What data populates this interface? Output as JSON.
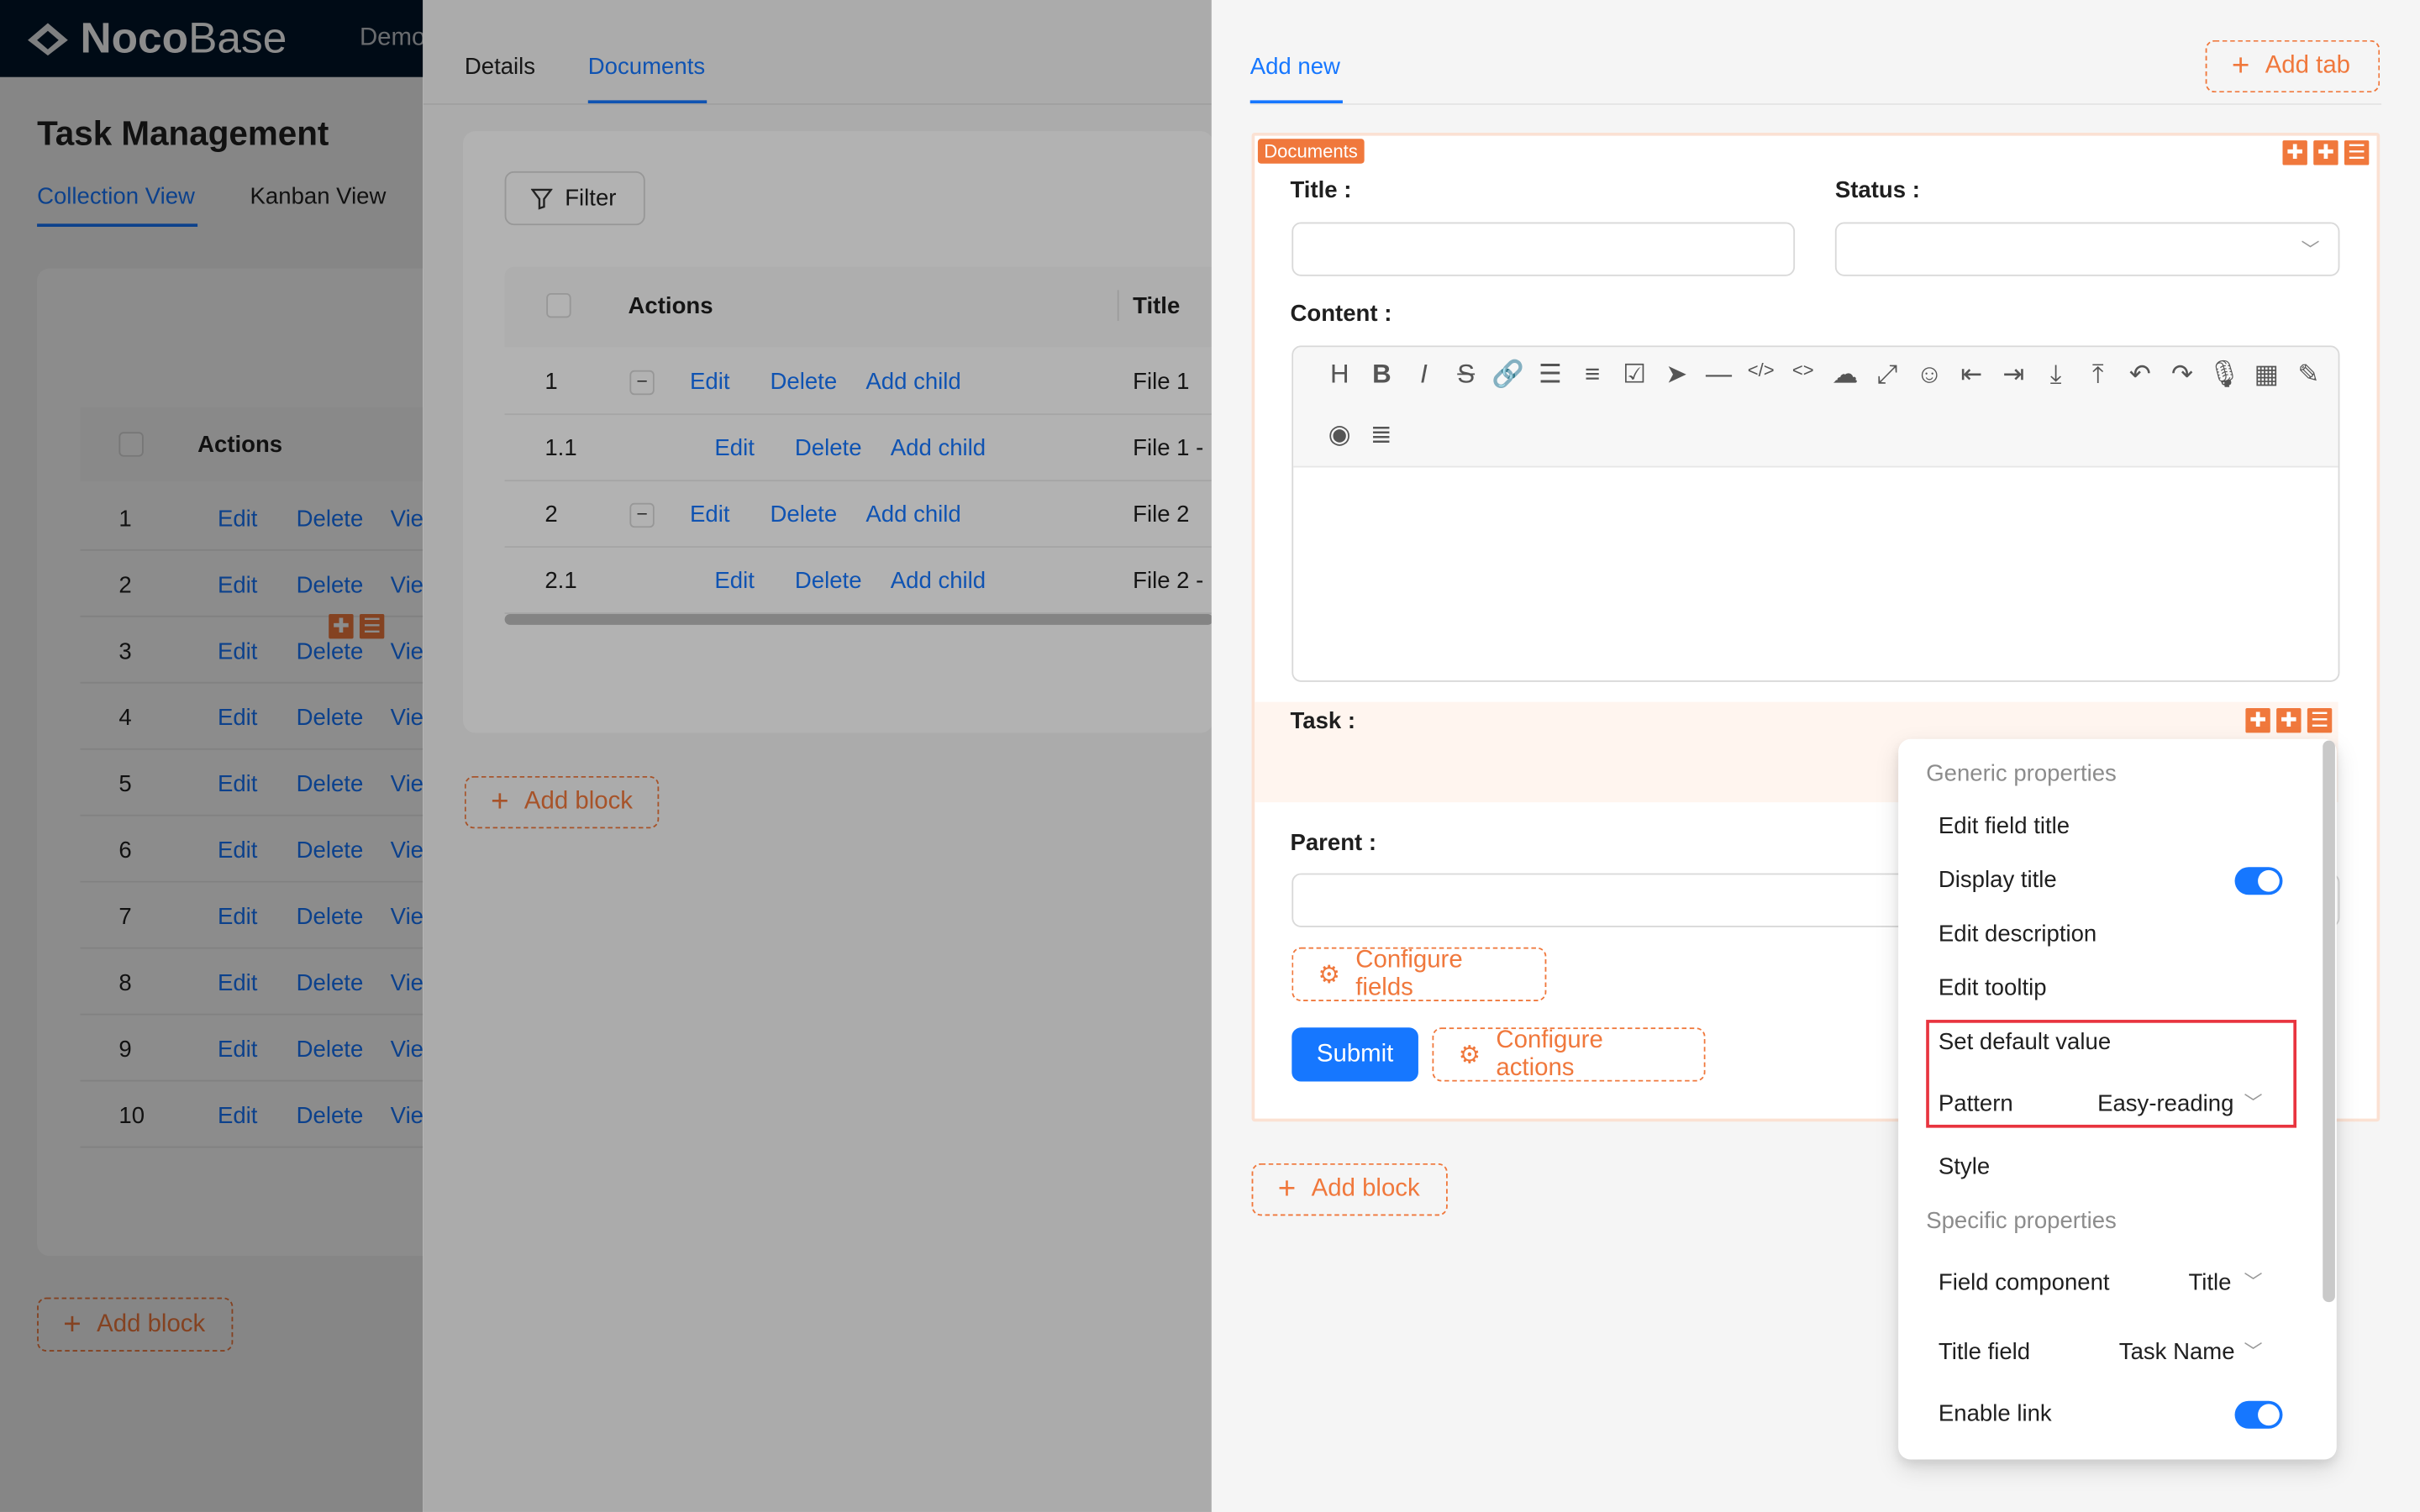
{
  "app": {
    "logo_bold": "Noco",
    "logo_light": "Base",
    "nav_item": "Demo"
  },
  "page": {
    "title": "Task Management",
    "tabs": [
      "Collection View",
      "Kanban View"
    ]
  },
  "bg_table": {
    "header": "Actions",
    "rows": [
      "1",
      "2",
      "3",
      "4",
      "5",
      "6",
      "7",
      "8",
      "9",
      "10"
    ],
    "edit": "Edit",
    "delete": "Delete",
    "view": "Vie"
  },
  "bg_add_block": "Add block",
  "mid": {
    "tabs": [
      "Details",
      "Documents"
    ],
    "filter": "Filter",
    "header_actions": "Actions",
    "header_title": "Title",
    "rows": [
      {
        "id": "1",
        "collapse": "–",
        "title": "File 1"
      },
      {
        "id": "1.1",
        "collapse": "",
        "title": "File 1 -"
      },
      {
        "id": "2",
        "collapse": "–",
        "title": "File 2"
      },
      {
        "id": "2.1",
        "collapse": "",
        "title": "File 2 -"
      }
    ],
    "edit": "Edit",
    "delete": "Delete",
    "add_child": "Add child",
    "add_block": "Add block"
  },
  "drawer": {
    "tab": "Add new",
    "add_tab": "Add tab",
    "block_badge": "Documents",
    "title_label": "Title",
    "status_label": "Status",
    "content_label": "Content",
    "task_label": "Task",
    "parent_label": "Parent",
    "configure_fields": "Configure fields",
    "submit": "Submit",
    "configure_actions": "Configure actions",
    "add_block": "Add block"
  },
  "menu": {
    "generic_header": "Generic properties",
    "edit_field_title": "Edit field title",
    "display_title": "Display title",
    "edit_description": "Edit description",
    "edit_tooltip": "Edit tooltip",
    "set_default_value": "Set default value",
    "pattern": "Pattern",
    "pattern_value": "Easy-reading",
    "style": "Style",
    "specific_header": "Specific properties",
    "field_component": "Field component",
    "field_component_value": "Title",
    "title_field": "Title field",
    "title_field_value": "Task Name",
    "enable_link": "Enable link"
  },
  "colors": {
    "accent": "#1677ff",
    "designer_orange": "#f0783c",
    "highlight_red": "#e8343f"
  }
}
